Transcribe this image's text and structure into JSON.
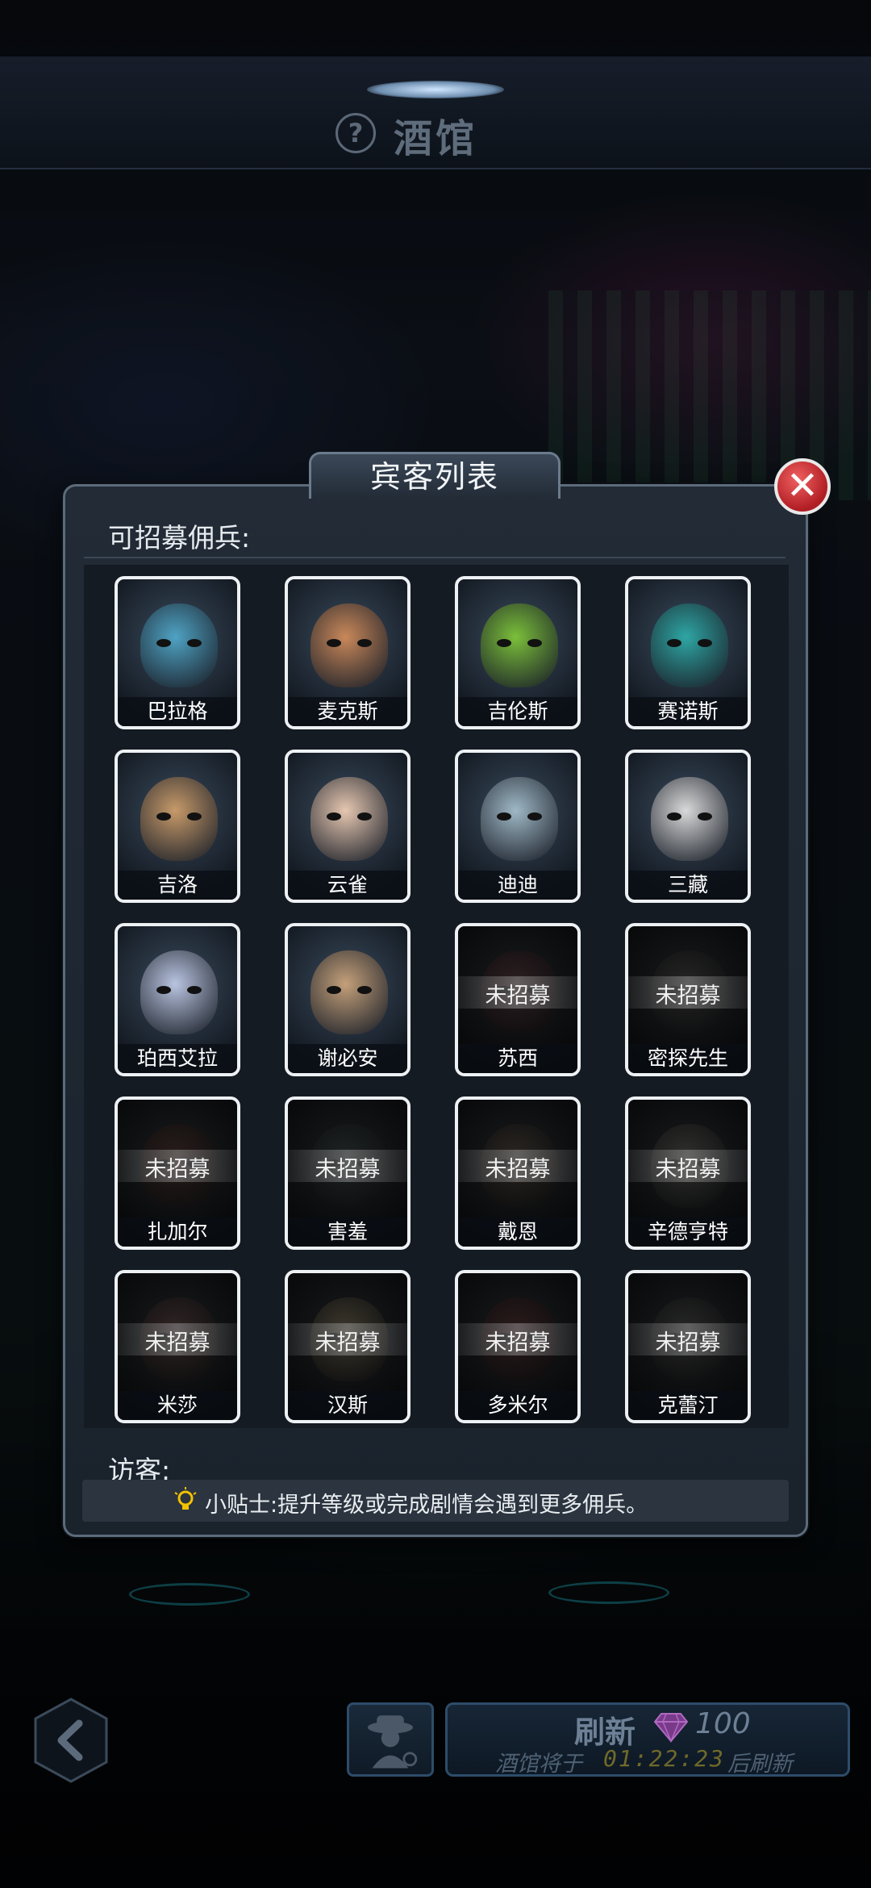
{
  "header": {
    "title": "酒馆"
  },
  "dialog": {
    "title": "宾客列表",
    "recruitable_label": "可招募佣兵:",
    "visitors_label": "访客:",
    "tip": "小贴士:提升等级或完成剧情会遇到更多佣兵。",
    "locked_label": "未招募",
    "mercenaries": [
      {
        "name": "巴拉格",
        "recruited": true,
        "color": "#4fa3c4"
      },
      {
        "name": "麦克斯",
        "recruited": true,
        "color": "#c9885a"
      },
      {
        "name": "吉伦斯",
        "recruited": true,
        "color": "#7bbf3a"
      },
      {
        "name": "赛诺斯",
        "recruited": true,
        "color": "#2ea6a4"
      },
      {
        "name": "吉洛",
        "recruited": true,
        "color": "#c79a6a"
      },
      {
        "name": "云雀",
        "recruited": true,
        "color": "#e6c7b1"
      },
      {
        "name": "迪迪",
        "recruited": true,
        "color": "#9fb8c6"
      },
      {
        "name": "三藏",
        "recruited": true,
        "color": "#d9d9d9"
      },
      {
        "name": "珀西艾拉",
        "recruited": true,
        "color": "#b9c4e0"
      },
      {
        "name": "谢必安",
        "recruited": true,
        "color": "#c4a07a"
      },
      {
        "name": "苏西",
        "recruited": false,
        "color": "#b04a5a"
      },
      {
        "name": "密探先生",
        "recruited": false,
        "color": "#6a6a6a"
      },
      {
        "name": "扎加尔",
        "recruited": false,
        "color": "#a04a3a"
      },
      {
        "name": "害羞",
        "recruited": false,
        "color": "#4a6a6a"
      },
      {
        "name": "戴恩",
        "recruited": false,
        "color": "#8a6a4a"
      },
      {
        "name": "辛德亨特",
        "recruited": false,
        "color": "#8a8a7a"
      },
      {
        "name": "米莎",
        "recruited": false,
        "color": "#b0605a"
      },
      {
        "name": "汉斯",
        "recruited": false,
        "color": "#c0a050"
      },
      {
        "name": "多米尔",
        "recruited": false,
        "color": "#b04040"
      },
      {
        "name": "克蕾汀",
        "recruited": false,
        "color": "#707070"
      }
    ]
  },
  "bottom": {
    "refresh_label": "刷新",
    "refresh_cost": "100",
    "refresh_prefix": "酒馆将于",
    "timer": "01:22:23",
    "refresh_suffix": "后刷新"
  }
}
